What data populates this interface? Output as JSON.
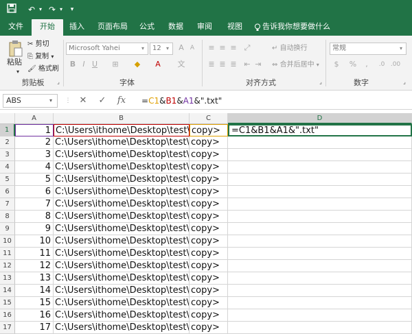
{
  "tabs": [
    {
      "label": "文件"
    },
    {
      "label": "开始"
    },
    {
      "label": "插入"
    },
    {
      "label": "页面布局"
    },
    {
      "label": "公式"
    },
    {
      "label": "数据"
    },
    {
      "label": "审阅"
    },
    {
      "label": "视图"
    },
    {
      "label": "告诉我你想要做什么"
    }
  ],
  "ribbon": {
    "paste": "粘贴",
    "cut": "剪切",
    "copy": "复制",
    "format_painter": "格式刷",
    "clipboard_label": "剪贴板",
    "font_name": "Microsoft Yahei",
    "font_size": "12",
    "font_label": "字体",
    "wrap_text": "自动换行",
    "merge_center": "合并后居中",
    "alignment_label": "对齐方式",
    "number_format": "常规",
    "number_label": "数字"
  },
  "formula_bar": {
    "name_box": "ABS",
    "cancel": "✕",
    "enter": "✓",
    "fx": "fx",
    "formula": "=C1&B1&A1&\".txt\""
  },
  "columns": [
    "A",
    "B",
    "C",
    "D"
  ],
  "rows": [
    {
      "row": "1",
      "a": "1",
      "b": "C:\\Users\\ithome\\Desktop\\test\\",
      "c": "copy>",
      "d": "=C1&B1&A1&\".txt\""
    },
    {
      "row": "2",
      "a": "2",
      "b": "C:\\Users\\ithome\\Desktop\\test\\",
      "c": "copy>",
      "d": ""
    },
    {
      "row": "3",
      "a": "3",
      "b": "C:\\Users\\ithome\\Desktop\\test\\",
      "c": "copy>",
      "d": ""
    },
    {
      "row": "4",
      "a": "4",
      "b": "C:\\Users\\ithome\\Desktop\\test\\",
      "c": "copy>",
      "d": ""
    },
    {
      "row": "5",
      "a": "5",
      "b": "C:\\Users\\ithome\\Desktop\\test\\",
      "c": "copy>",
      "d": ""
    },
    {
      "row": "6",
      "a": "6",
      "b": "C:\\Users\\ithome\\Desktop\\test\\",
      "c": "copy>",
      "d": ""
    },
    {
      "row": "7",
      "a": "7",
      "b": "C:\\Users\\ithome\\Desktop\\test\\",
      "c": "copy>",
      "d": ""
    },
    {
      "row": "8",
      "a": "8",
      "b": "C:\\Users\\ithome\\Desktop\\test\\",
      "c": "copy>",
      "d": ""
    },
    {
      "row": "9",
      "a": "9",
      "b": "C:\\Users\\ithome\\Desktop\\test\\",
      "c": "copy>",
      "d": ""
    },
    {
      "row": "10",
      "a": "10",
      "b": "C:\\Users\\ithome\\Desktop\\test\\",
      "c": "copy>",
      "d": ""
    },
    {
      "row": "11",
      "a": "11",
      "b": "C:\\Users\\ithome\\Desktop\\test\\",
      "c": "copy>",
      "d": ""
    },
    {
      "row": "12",
      "a": "12",
      "b": "C:\\Users\\ithome\\Desktop\\test\\",
      "c": "copy>",
      "d": ""
    },
    {
      "row": "13",
      "a": "13",
      "b": "C:\\Users\\ithome\\Desktop\\test\\",
      "c": "copy>",
      "d": ""
    },
    {
      "row": "14",
      "a": "14",
      "b": "C:\\Users\\ithome\\Desktop\\test\\",
      "c": "copy>",
      "d": ""
    },
    {
      "row": "15",
      "a": "15",
      "b": "C:\\Users\\ithome\\Desktop\\test\\",
      "c": "copy>",
      "d": ""
    },
    {
      "row": "16",
      "a": "16",
      "b": "C:\\Users\\ithome\\Desktop\\test\\",
      "c": "copy>",
      "d": ""
    },
    {
      "row": "17",
      "a": "17",
      "b": "C:\\Users\\ithome\\Desktop\\test\\",
      "c": "copy>",
      "d": ""
    }
  ],
  "colors": {
    "accent": "#217346",
    "ref_c1": "#e0a000",
    "ref_b1": "#c00000",
    "ref_a1": "#7030a0"
  }
}
